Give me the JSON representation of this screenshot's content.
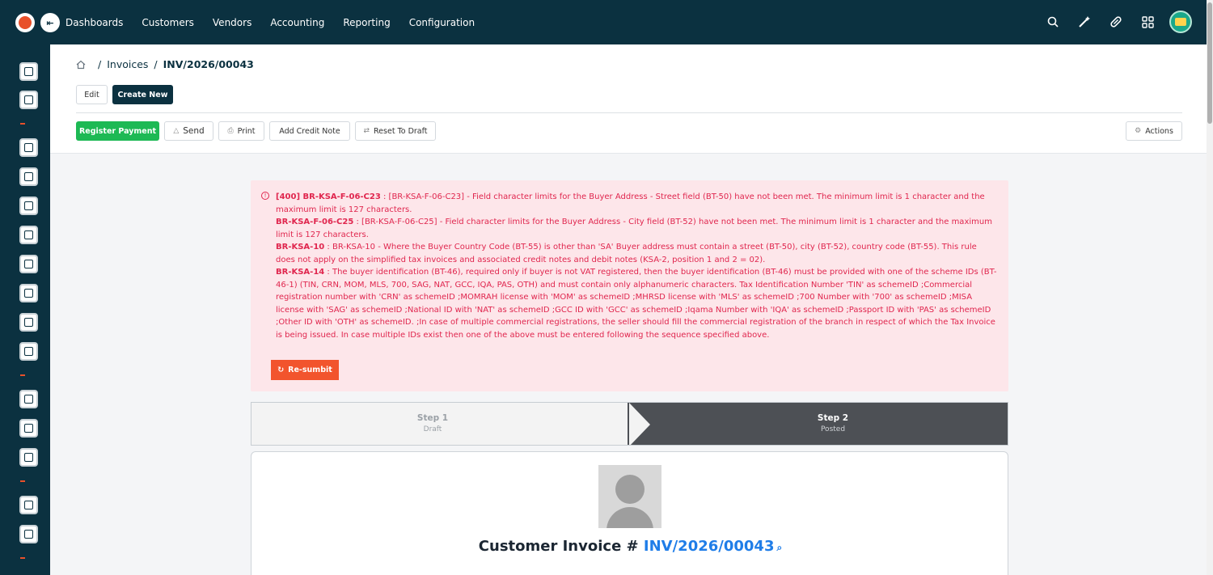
{
  "topbar": {
    "nav": [
      "Dashboards",
      "Customers",
      "Vendors",
      "Accounting",
      "Reporting",
      "Configuration"
    ],
    "icons": [
      "search-icon",
      "magic-wand-icon",
      "pill-icon",
      "apps-grid-icon"
    ]
  },
  "breadcrumb": {
    "section": "Invoices",
    "separator": "/",
    "current": "INV/2026/00043"
  },
  "header_buttons": {
    "edit": "Edit",
    "create_new": "Create New"
  },
  "toolbar": {
    "register_payment": "Register Payment",
    "send": "Send",
    "print": "Print",
    "add_credit_note": "Add Credit Note",
    "reset_to_draft": "Reset To Draft",
    "actions": "Actions"
  },
  "alert": {
    "errors": [
      {
        "code": "[400] BR-KSA-F-06-C23",
        "text": " : [BR-KSA-F-06-C23] - Field character limits for the Buyer Address - Street field (BT-50) have not been met. The minimum limit is 1 character and the maximum limit is 127 characters."
      },
      {
        "code": "BR-KSA-F-06-C25",
        "text": " : [BR-KSA-F-06-C25] - Field character limits for the Buyer Address - City field (BT-52) have not been met. The minimum limit is 1 character and the maximum limit is 127 characters."
      },
      {
        "code": "BR-KSA-10",
        "text": " : BR-KSA-10 - Where the Buyer Country Code (BT-55) is other than 'SA' Buyer address must contain a street (BT-50), city (BT-52), country code (BT-55). This rule does not apply on the simplified tax invoices and associated credit notes and debit notes (KSA-2, position 1 and 2 = 02)."
      },
      {
        "code": "BR-KSA-14",
        "text": " : The buyer identification (BT-46), required only if buyer is not VAT registered, then the buyer identification (BT-46) must be provided with one of the scheme IDs (BT-46-1) (TIN, CRN, MOM, MLS, 700, SAG, NAT, GCC, IQA, PAS, OTH) and must contain only alphanumeric characters. Tax Identification Number 'TIN' as schemeID ;Commercial registration number with 'CRN' as schemeID ;MOMRAH license with 'MOM' as schemeID ;MHRSD license with 'MLS' as schemeID ;700 Number with '700' as schemeID ;MISA license with 'SAG' as schemeID ;National ID with 'NAT' as schemeID ;GCC ID with 'GCC' as schemeID ;Iqama Number with 'IQA' as schemeID ;Passport ID with 'PAS' as schemeID ;Other ID with 'OTH' as schemeID. ;In case of multiple commercial registrations, the seller should fill the commercial registration of the branch in respect of which the Tax Invoice is being issued. In case multiple IDs exist then one of the above must be entered following the sequence specified above."
      }
    ],
    "resubmit": "Re-sumbit"
  },
  "stepper": {
    "steps": [
      {
        "title": "Step 1",
        "subtitle": "Draft"
      },
      {
        "title": "Step 2",
        "subtitle": "Posted"
      }
    ],
    "active_index": 1
  },
  "invoice": {
    "title_prefix": "Customer Invoice #",
    "number": "INV/2026/00043"
  },
  "colors": {
    "topbar": "#0b3140",
    "accent_green": "#1db954",
    "alert_text": "#e0264e",
    "alert_bg": "#fde6ea",
    "resubmit": "#f2542d",
    "link": "#1f7de8"
  }
}
